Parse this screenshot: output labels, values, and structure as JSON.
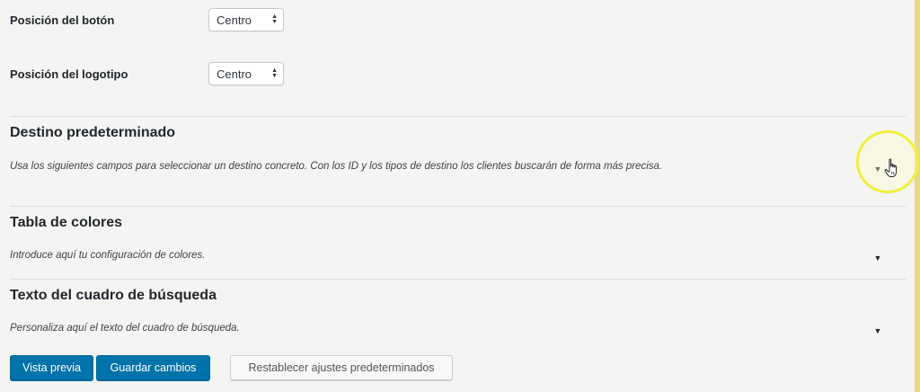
{
  "settings": {
    "button_position": {
      "label": "Posición del botón",
      "value": "Centro"
    },
    "logo_position": {
      "label": "Posición del logotipo",
      "value": "Centro"
    }
  },
  "sections": [
    {
      "title": "Destino predeterminado",
      "description": "Usa los siguientes campos para seleccionar un destino concreto. Con los ID y los tipos de destino los clientes buscarán de forma más precisa."
    },
    {
      "title": "Tabla de colores",
      "description": "Introduce aquí tu configuración de colores."
    },
    {
      "title": "Texto del cuadro de búsqueda",
      "description": "Personaliza aquí el texto del cuadro de búsqueda."
    }
  ],
  "buttons": {
    "preview": "Vista previa",
    "save": "Guardar cambios",
    "reset": "Restablecer ajustes predeterminados"
  },
  "colors": {
    "primary": "#0073aa",
    "highlight": "#f1ee3c"
  },
  "icons": {
    "toggle": "triangle-down-icon",
    "cursor": "hand-pointer-icon"
  }
}
